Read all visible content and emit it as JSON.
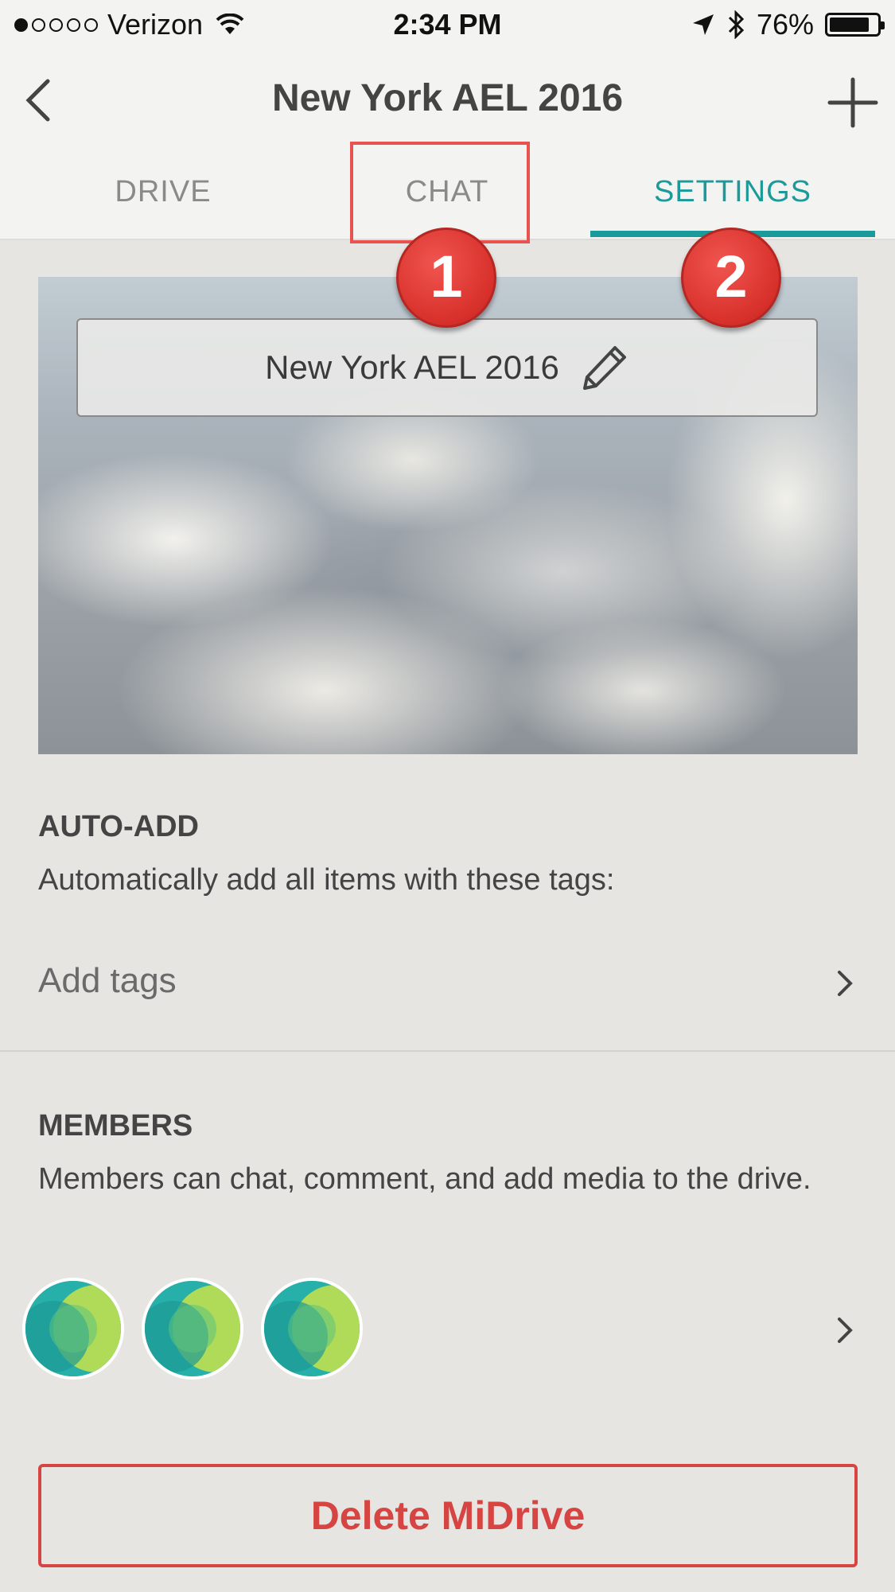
{
  "status_bar": {
    "carrier": "Verizon",
    "time": "2:34 PM",
    "battery_percent": "76%",
    "battery_level": 0.76,
    "signal_bars_filled": 1,
    "signal_bars_total": 5
  },
  "nav": {
    "title": "New York AEL 2016",
    "back_icon": "chevron-left-icon",
    "add_icon": "plus-icon"
  },
  "tabs": [
    {
      "label": "DRIVE",
      "active": false
    },
    {
      "label": "CHAT",
      "active": false
    },
    {
      "label": "SETTINGS",
      "active": true
    }
  ],
  "annotations": {
    "badge_1": "1",
    "badge_2": "2",
    "highlight_color": "#e8534f"
  },
  "cover": {
    "drive_name": "New York AEL 2016",
    "edit_icon": "pencil-icon"
  },
  "auto_add": {
    "title": "AUTO-ADD",
    "description": "Automatically add all items with these tags:",
    "tags_placeholder": "Add tags"
  },
  "members": {
    "title": "MEMBERS",
    "description": "Members can chat, comment, and add media to the drive.",
    "avatar_count": 3
  },
  "delete_button": {
    "label": "Delete MiDrive"
  },
  "colors": {
    "accent": "#1a9a9a",
    "danger": "#d64541",
    "background": "#e6e5e2"
  }
}
